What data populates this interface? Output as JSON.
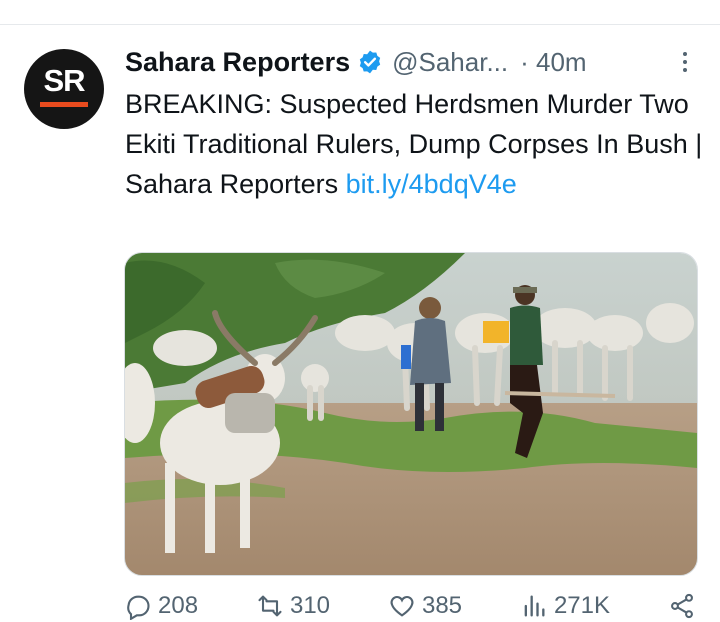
{
  "tweet": {
    "avatar_text": "SR",
    "display_name": "Sahara Reporters",
    "handle": "@Sahar...",
    "time": "· 40m",
    "text": "BREAKING: Suspected Herdsmen Murder Two Ekiti Traditional Rulers, Dump Corpses In Bush | Sahara Reporters ",
    "link": "bit.ly/4bdqV4e",
    "media_alt": "herdsmen walking with cattle on a dirt path"
  },
  "actions": {
    "replies": "208",
    "reposts": "310",
    "likes": "385",
    "views": "271K"
  },
  "colors": {
    "link": "#1d9bf0",
    "verified": "#1d9bf0",
    "brand_bar": "#e84b1e",
    "muted": "#536471"
  },
  "icons": [
    "verified-badge-icon",
    "more-options-icon",
    "reply-icon",
    "repost-icon",
    "like-icon",
    "views-icon",
    "share-icon"
  ]
}
